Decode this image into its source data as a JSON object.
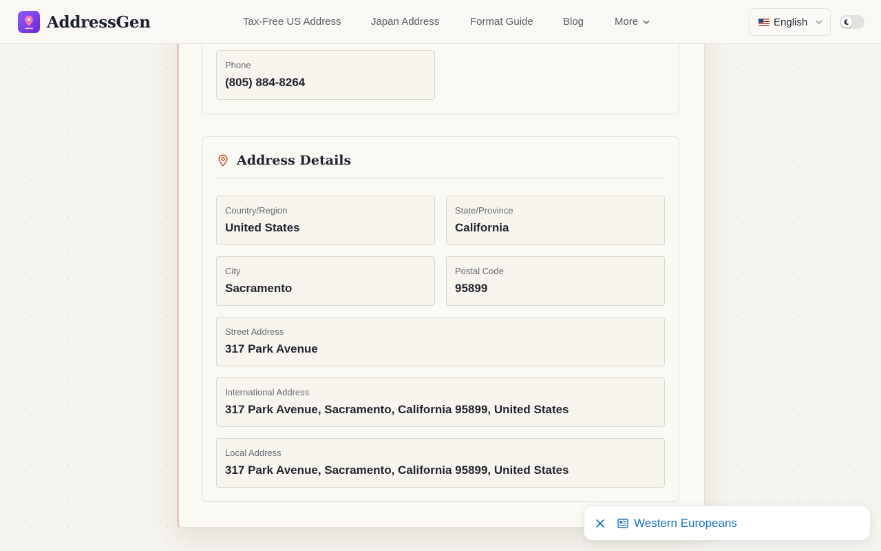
{
  "app": {
    "name": "AddressGen"
  },
  "nav": {
    "items": [
      {
        "label": "Tax-Free US Address"
      },
      {
        "label": "Japan Address"
      },
      {
        "label": "Format Guide"
      },
      {
        "label": "Blog"
      }
    ],
    "more_label": "More"
  },
  "language": {
    "selected": "English",
    "flag": "us-flag"
  },
  "theme_toggle": {
    "icon": "moon-icon"
  },
  "contact": {
    "phone": {
      "label": "Phone",
      "value": "(805) 884-8264"
    }
  },
  "address_details": {
    "title": "Address Details",
    "icon": "map-pin-icon",
    "fields": {
      "country": {
        "label": "Country/Region",
        "value": "United States"
      },
      "state": {
        "label": "State/Province",
        "value": "California"
      },
      "city": {
        "label": "City",
        "value": "Sacramento"
      },
      "postal": {
        "label": "Postal Code",
        "value": "95899"
      },
      "street": {
        "label": "Street Address",
        "value": "317 Park Avenue"
      },
      "international": {
        "label": "International Address",
        "value": "317 Park Avenue, Sacramento, California 95899, United States"
      },
      "local": {
        "label": "Local Address",
        "value": "317 Park Avenue, Sacramento, California 95899, United States"
      }
    }
  },
  "toast": {
    "link_label": "Western Europeans",
    "icon": "news-icon"
  },
  "colors": {
    "brand": "#7c3aed",
    "accent_pin": "#d8573f",
    "link": "#1a73c9"
  }
}
